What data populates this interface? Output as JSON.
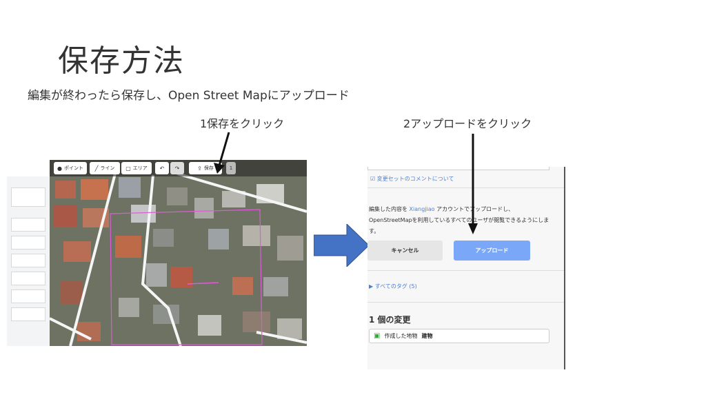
{
  "slide": {
    "title": "保存方法",
    "subtitle": "編集が終わったら保存し、Open Street Mapにアップロード",
    "step1": "1保存をクリック",
    "step2": "2アップロードをクリック"
  },
  "editor": {
    "toolbar": {
      "point": "ポイント",
      "line": "ライン",
      "area": "エリア",
      "save": "保存",
      "count": "1"
    }
  },
  "upload_panel": {
    "comment_link": "変更セットのコメントについて",
    "upload_text_pre": "編集した内容を",
    "username": "Xiangjiao",
    "upload_text_post": "アカウントでアップロードし、OpenStreetMapを利用しているすべてのユーザが閲覧できるようにします。",
    "cancel_label": "キャンセル",
    "upload_label": "アップロード",
    "all_tags": "▶ すべてのタグ (5)",
    "changes_heading": "1 個の変更",
    "change_item_action": "作成した地物",
    "change_item_type": "建物"
  },
  "colors": {
    "accent_blue": "#4f7fce",
    "upload_button": "#7aa7f7",
    "big_arrow": "#4472c4"
  }
}
